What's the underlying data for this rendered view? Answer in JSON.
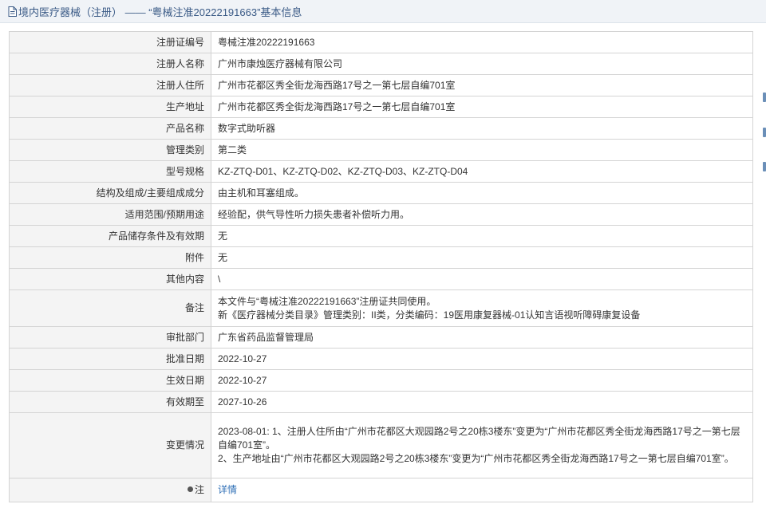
{
  "header": {
    "title": "境内医疗器械（注册） —— “粤械注准20222191663”基本信息",
    "icon": "document-icon"
  },
  "rows": [
    {
      "label": "注册证编号",
      "value": "粤械注准20222191663"
    },
    {
      "label": "注册人名称",
      "value": "广州市康烛医疗器械有限公司"
    },
    {
      "label": "注册人住所",
      "value": "广州市花都区秀全街龙海西路17号之一第七层自编701室"
    },
    {
      "label": "生产地址",
      "value": "广州市花都区秀全街龙海西路17号之一第七层自编701室"
    },
    {
      "label": "产品名称",
      "value": "数字式助听器"
    },
    {
      "label": "管理类别",
      "value": "第二类"
    },
    {
      "label": "型号规格",
      "value": "KZ-ZTQ-D01、KZ-ZTQ-D02、KZ-ZTQ-D03、KZ-ZTQ-D04"
    },
    {
      "label": "结构及组成/主要组成成分",
      "value": "由主机和耳塞组成。"
    },
    {
      "label": "适用范围/预期用途",
      "value": "经验配，供气导性听力损失患者补偿听力用。"
    },
    {
      "label": "产品储存条件及有效期",
      "value": "无"
    },
    {
      "label": "附件",
      "value": "无"
    },
    {
      "label": "其他内容",
      "value": "\\"
    }
  ],
  "remarks": {
    "label": "备注",
    "line1": "本文件与“粤械注准20222191663”注册证共同使用。",
    "line2": "新《医疗器械分类目录》管理类别：II类，分类编码：19医用康复器械-01认知言语视听障碍康复设备"
  },
  "rows2": [
    {
      "label": "审批部门",
      "value": "广东省药品监督管理局"
    },
    {
      "label": "批准日期",
      "value": "2022-10-27"
    },
    {
      "label": "生效日期",
      "value": "2022-10-27"
    },
    {
      "label": "有效期至",
      "value": "2027-10-26"
    }
  ],
  "changes": {
    "label": "变更情况",
    "line1": "2023-08-01: 1、注册人住所由“广州市花都区大观园路2号之20栋3楼东”变更为“广州市花都区秀全街龙海西路17号之一第七层自编701室”。",
    "line2": "2、生产地址由“广州市花都区大观园路2号之20栋3楼东”变更为“广州市花都区秀全街龙海西路17号之一第七层自编701室”。"
  },
  "note": {
    "label": "注",
    "link": "详情",
    "icon": "pin-icon"
  },
  "colors": {
    "title_text": "#3a5a86",
    "link": "#2f6fb6",
    "label_bg": "#f4f4f4",
    "border": "#d4d4d4"
  }
}
